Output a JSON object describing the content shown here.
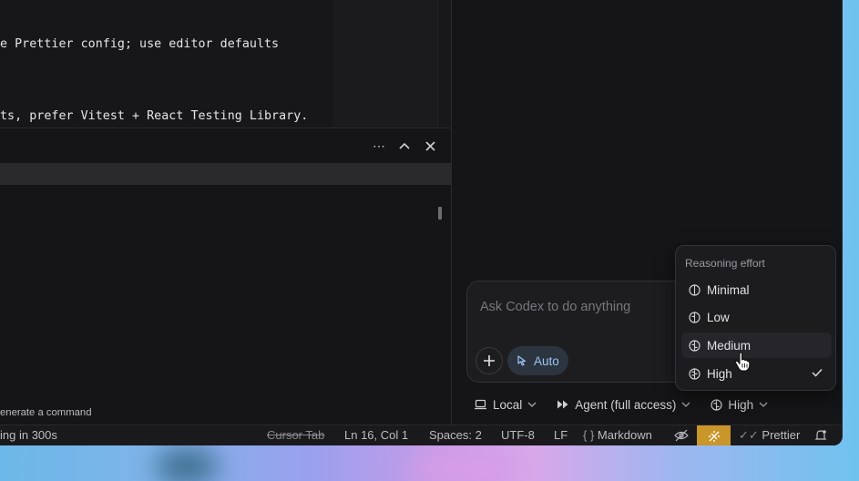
{
  "editor": {
    "lines": [
      "e Prettier config; use editor defaults",
      "ts, prefer Vitest + React Testing Library."
    ]
  },
  "panel": {
    "hint": "enerate a command"
  },
  "composer": {
    "placeholder": "Ask Codex to do anything",
    "auto_label": "Auto"
  },
  "toolbar": {
    "local_label": "Local",
    "agent_label": "Agent (full access)",
    "effort_label": "High"
  },
  "dropdown": {
    "heading": "Reasoning effort",
    "items": [
      {
        "label": "Minimal",
        "selected": false
      },
      {
        "label": "Low",
        "selected": false
      },
      {
        "label": "Medium",
        "selected": false
      },
      {
        "label": "High",
        "selected": true
      }
    ]
  },
  "status": {
    "left": "ing in 300s",
    "cursor_tab": "Cursor Tab",
    "position": "Ln 16, Col 1",
    "spaces": "Spaces: 2",
    "encoding": "UTF-8",
    "eol": "LF",
    "language": "Markdown",
    "prettier": "Prettier"
  },
  "colors": {
    "accent_blue": "#9cc4f2",
    "warning": "#c9962a"
  }
}
